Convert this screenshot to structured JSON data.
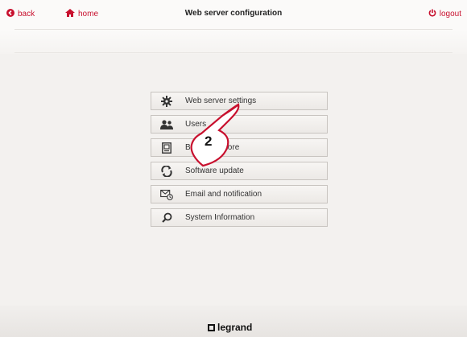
{
  "header": {
    "back_label": "back",
    "home_label": "home",
    "title": "Web server configuration",
    "logout_label": "logout"
  },
  "menu": {
    "items": [
      {
        "label": "Web server settings",
        "icon": "gear-icon"
      },
      {
        "label": "Users",
        "icon": "users-icon"
      },
      {
        "label": "Backup restore",
        "icon": "backup-icon"
      },
      {
        "label": "Software update",
        "icon": "update-icon"
      },
      {
        "label": "Email and notification",
        "icon": "email-notification-icon"
      },
      {
        "label": "System Information",
        "icon": "search-icon"
      }
    ]
  },
  "callout": {
    "number": "2"
  },
  "footer": {
    "brand": "legrand"
  },
  "colors": {
    "accent": "#c8102e",
    "background": "#f3f1ef"
  }
}
